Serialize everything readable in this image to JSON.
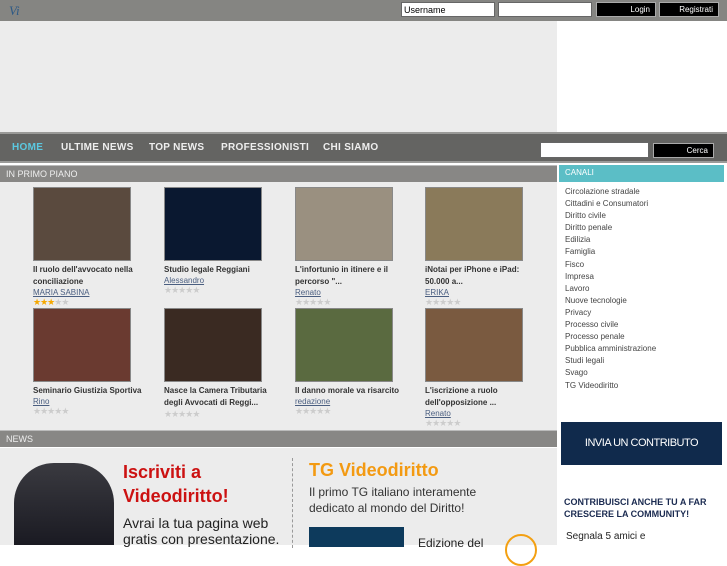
{
  "header": {
    "logo": "Vi",
    "username_placeholder": "Username",
    "login": "Login",
    "register": "Registrati"
  },
  "nav": {
    "items": [
      "HOME",
      "ULTIME NEWS",
      "TOP NEWS",
      "PROFESSIONISTI",
      "CHI SIAMO"
    ],
    "search_button": "Cerca"
  },
  "primo_piano": {
    "title": "IN PRIMO PIANO",
    "videos": [
      {
        "title": "Il ruolo dell'avvocato nella conciliazione",
        "author": "MARIA SABINA",
        "rating": 3
      },
      {
        "title": "Studio legale Reggiani",
        "author": "Alessandro",
        "rating": 0
      },
      {
        "title": "L'infortunio in itinere e il percorso \"...",
        "author": "Renato",
        "rating": 0
      },
      {
        "title": "iNotai per iPhone e iPad: 50.000 a...",
        "author": "ERIKA",
        "rating": 0
      },
      {
        "title": "Seminario Giustizia Sportiva",
        "author": "Rino",
        "rating": 0
      },
      {
        "title": "Nasce la Camera Tributaria degli Avvocati di Reggi...",
        "author": "",
        "rating": 0
      },
      {
        "title": "Il danno morale va risarcito",
        "author": "redazione",
        "rating": 0
      },
      {
        "title": "L'iscrizione a ruolo dell'opposizione ...",
        "author": "Renato",
        "rating": 0
      }
    ]
  },
  "canali": {
    "title": "CANALI",
    "items": [
      "Circolazione stradale",
      "Cittadini e Consumatori",
      "Diritto civile",
      "Diritto penale",
      "Edilizia",
      "Famiglia",
      "Fisco",
      "Impresa",
      "Lavoro",
      "Nuove tecnologie",
      "Privacy",
      "Processo civile",
      "Processo penale",
      "Pubblica amministrazione",
      "Studi legali",
      "Svago",
      "TG Videodiritto"
    ]
  },
  "news": {
    "title": "NEWS",
    "signup_title": "Iscriviti a Videodiritto!",
    "signup_text": "Avrai la tua pagina web gratis con presentazione.",
    "tg_title": "TG Videodiritto",
    "tg_text": "Il primo TG italiano interamente dedicato al mondo del Diritto!",
    "tg_edition": "Edizione del"
  },
  "sidebar": {
    "contribute": "INVIA UN CONTRIBUTO",
    "community": "CONTRIBUISCI ANCHE TU A FAR CRESCERE LA COMMUNITY!",
    "invite": "Segnala 5 amici e"
  }
}
